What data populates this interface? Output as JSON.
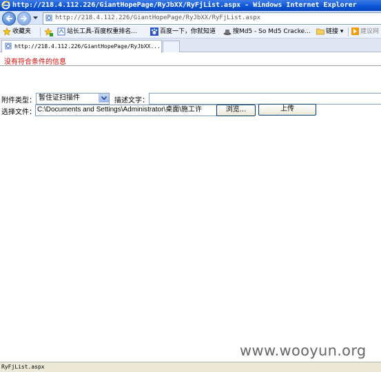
{
  "window": {
    "title": "http://218.4.112.226/GiantHopePage/RyJbXX/RyFjList.aspx - Windows Internet Explorer"
  },
  "address_bar": {
    "url": "http://218.4.112.226/GiantHopePage/RyJbXX/RyFjList.aspx"
  },
  "favorites_bar": {
    "favorites_label": "收藏夹",
    "items": [
      {
        "label": "站长工具-百度权重排名...",
        "icon": "page-icon"
      },
      {
        "label": "百度一下，你就知道",
        "icon": "baidu-paw-icon"
      },
      {
        "label": "搜Md5 - So Md5 Cracke...",
        "icon": "hat-icon"
      },
      {
        "label": "链接 ▾",
        "icon": "folder-icon"
      },
      {
        "label": "建议网",
        "icon": "suggest-icon"
      }
    ]
  },
  "tabs": [
    {
      "label": "http://218.4.112.226/GiantHopePage/RyJbXX..."
    }
  ],
  "content": {
    "message": "没有符合条件的信息",
    "attachment_type_label": "附件类型：",
    "attachment_type_value": "暂住证扫描件",
    "description_label": "描述文字：",
    "description_value": "",
    "file_label": "选择文件：",
    "file_value": "C:\\Documents and Settings\\Administrator\\桌面\\施工许",
    "browse_button": "浏览...",
    "upload_button": "上传"
  },
  "watermark": "www.wooyun.org",
  "status_bar": {
    "text": "RyFjList.aspx"
  },
  "colors": {
    "message": "#e00000",
    "title_bar": "#0a54d6"
  }
}
